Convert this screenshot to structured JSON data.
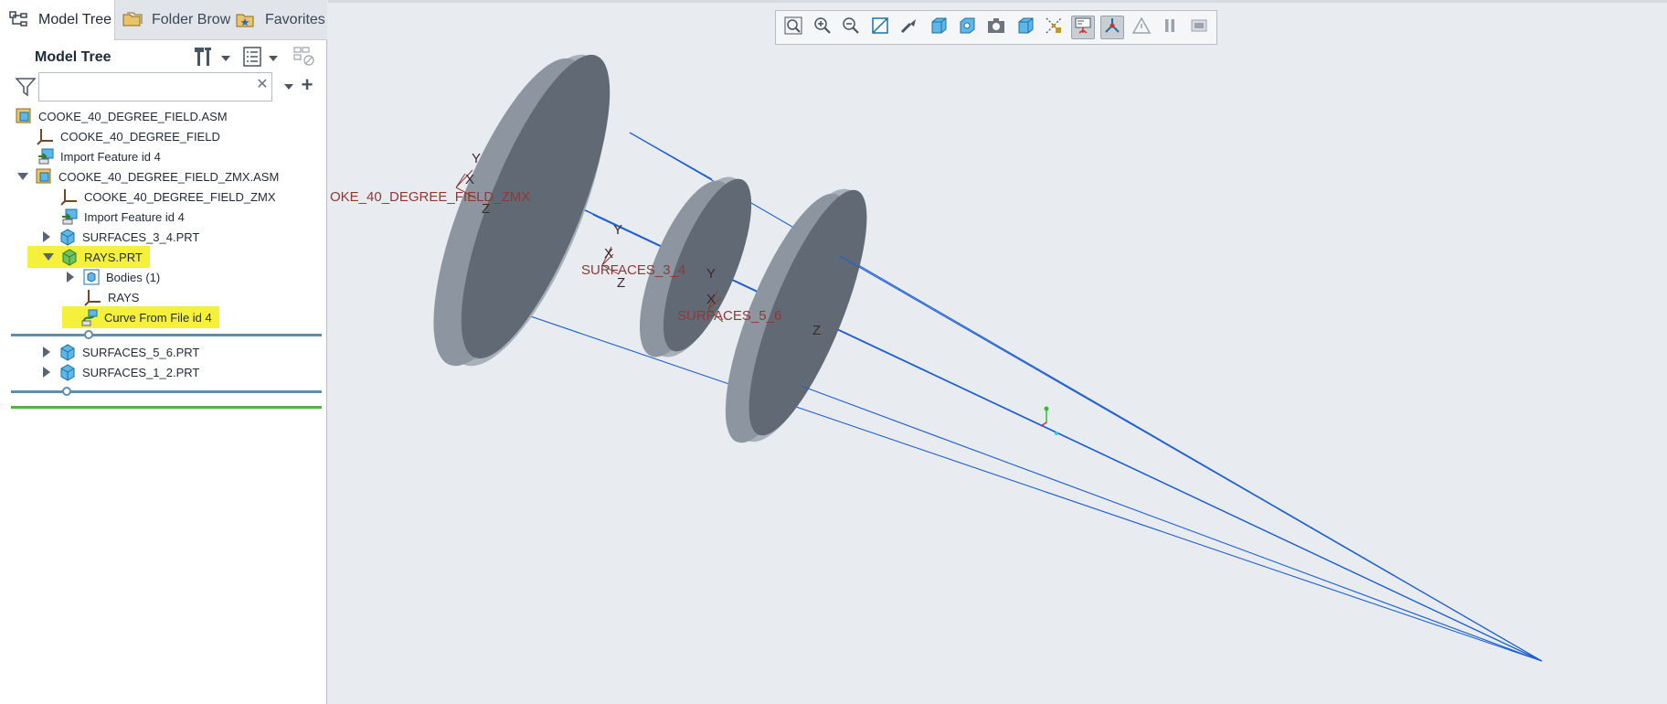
{
  "tabs": [
    {
      "label": "Model Tree",
      "icon": "model-tree-icon"
    },
    {
      "label": "Folder Brow",
      "icon": "folder-browser-icon"
    },
    {
      "label": "Favorites",
      "icon": "favorites-icon"
    }
  ],
  "header": {
    "title": "Model Tree"
  },
  "search": {
    "value": "",
    "clear": "✕",
    "add": "+"
  },
  "tree": [
    {
      "label": "COOKE_40_DEGREE_FIELD.ASM",
      "icon": "assembly-icon"
    },
    {
      "label": "COOKE_40_DEGREE_FIELD",
      "icon": "csys-icon"
    },
    {
      "label": "Import Feature id 4",
      "icon": "import-feature-icon"
    },
    {
      "label": "COOKE_40_DEGREE_FIELD_ZMX.ASM",
      "icon": "assembly-icon",
      "expanded": true
    },
    {
      "label": "COOKE_40_DEGREE_FIELD_ZMX",
      "icon": "csys-icon"
    },
    {
      "label": "Import Feature id 4",
      "icon": "import-feature-icon"
    },
    {
      "label": "SURFACES_3_4.PRT",
      "icon": "part-icon",
      "expanded": false
    },
    {
      "label": "RAYS.PRT",
      "icon": "part-icon",
      "expanded": true,
      "highlighted": true
    },
    {
      "label": "Bodies (1)",
      "icon": "bodies-icon",
      "expanded": false
    },
    {
      "label": "RAYS",
      "icon": "csys-icon"
    },
    {
      "label": "Curve From File id 4",
      "icon": "curve-feature-icon",
      "highlighted": true
    },
    {
      "label": "SURFACES_5_6.PRT",
      "icon": "part-icon",
      "expanded": false
    },
    {
      "label": "SURFACES_1_2.PRT",
      "icon": "part-icon",
      "expanded": false
    }
  ],
  "toolbar": [
    "refit-icon",
    "zoom-in-icon",
    "zoom-out-icon",
    "repaint-icon",
    "perspective-icon",
    "display-style-icon",
    "saved-orientations-icon",
    "saved-views-icon",
    "view-manager-icon",
    "datum-display-icon",
    "spin-center-icon",
    "annotation-display-icon",
    "simulation-icon",
    "pause-icon",
    "clip-icon"
  ],
  "toolbar_active": [
    10,
    11
  ],
  "scene_labels": {
    "lens1": "OKE_40_DEGREE_FIELD_ZMX",
    "lens2": "SURFACES_3_4",
    "lens3": "SURFACES_5_6",
    "axis_x": "X",
    "axis_y": "Y",
    "axis_z": "Z"
  },
  "colors": {
    "lens_face": "#616a74",
    "lens_rim": "#a8b0b9",
    "ray": "#1b5fd6",
    "csys": "#8a3a3a",
    "highlight": "#f4f03c",
    "insert_line": "#5f8ea8",
    "green_line": "#4fb33e"
  }
}
